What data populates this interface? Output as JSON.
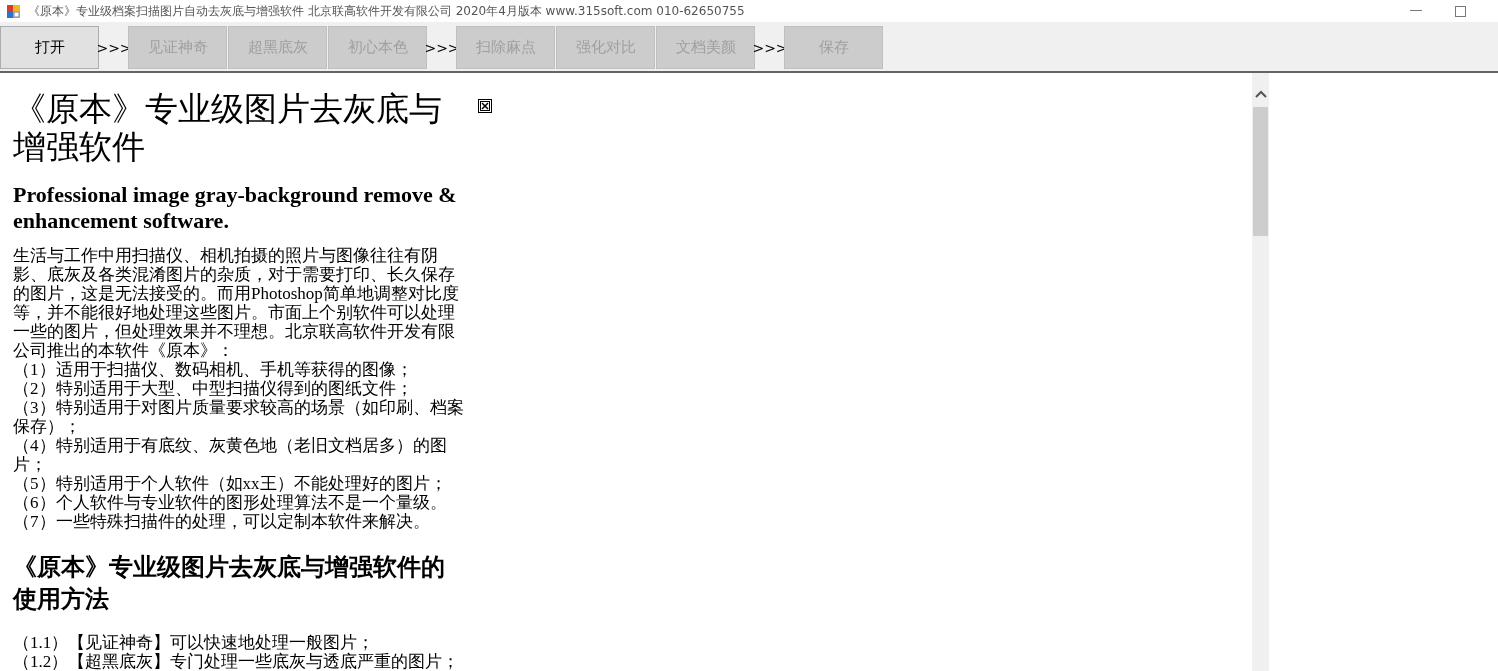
{
  "window": {
    "title": "《原本》专业级档案扫描图片自动去灰底与增强软件 北京联高软件开发有限公司 2020年4月版本 www.315soft.com 010-62650755"
  },
  "toolbar": [
    {
      "kind": "button",
      "label": "打开",
      "disabled": false
    },
    {
      "kind": "separator",
      "label": ">>>"
    },
    {
      "kind": "button",
      "label": "见证神奇",
      "disabled": true
    },
    {
      "kind": "button",
      "label": "超黑底灰",
      "disabled": true
    },
    {
      "kind": "button",
      "label": "初心本色",
      "disabled": true
    },
    {
      "kind": "separator",
      "label": ">>>"
    },
    {
      "kind": "button",
      "label": "扫除麻点",
      "disabled": true
    },
    {
      "kind": "button",
      "label": "强化对比",
      "disabled": true
    },
    {
      "kind": "button",
      "label": "文档美颜",
      "disabled": true
    },
    {
      "kind": "separator",
      "label": ">>>"
    },
    {
      "kind": "button",
      "label": "保存",
      "disabled": true
    }
  ],
  "document": {
    "heading": "《原本》专业级图片去灰底与增强软件",
    "subheading": "Professional image gray-background remove & enhancement software.",
    "intro": "生活与工作中用扫描仪、相机拍摄的照片与图像往往有阴影、底灰及各类混淆图片的杂质，对于需要打印、长久保存的图片，这是无法接受的。而用Photoshop简单地调整对比度等，并不能很好地处理这些图片。市面上个别软件可以处理一些的图片，但处理效果并不理想。北京联高软件开发有限公司推出的本软件《原本》：",
    "features": [
      "（1）适用于扫描仪、数码相机、手机等获得的图像；",
      "（2）特别适用于大型、中型扫描仪得到的图纸文件；",
      "（3）特别适用于对图片质量要求较高的场景（如印刷、档案保存）；",
      "（4）特别适用于有底纹、灰黄色地（老旧文档居多）的图片；",
      "（5）特别适用于个人软件（如xx王）不能处理好的图片；",
      "（6）个人软件与专业软件的图形处理算法不是一个量级。",
      "（7）一些特殊扫描件的处理，可以定制本软件来解决。"
    ],
    "usage_heading": "《原本》专业级图片去灰底与增强软件的使用方法",
    "usage": [
      "（1.1）【见证神奇】可以快速地处理一般图片；",
      "（1.2）【超黑底灰】专门处理一些底灰与透底严重的图片；"
    ]
  }
}
